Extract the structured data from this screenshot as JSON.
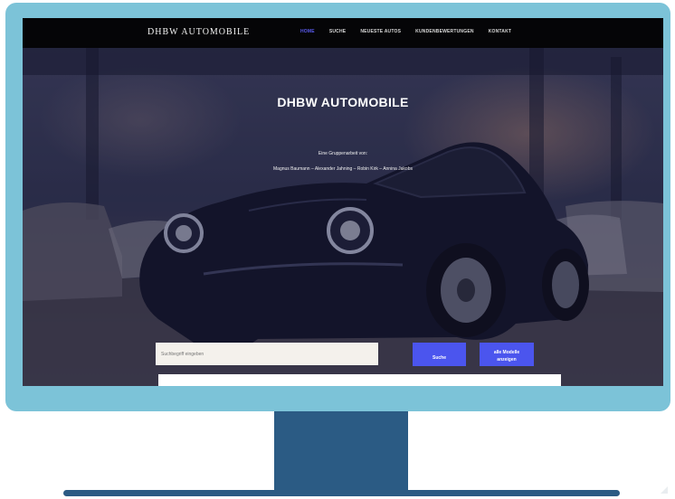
{
  "navbar": {
    "brand": "DHBW AUTOMOBILE",
    "links": [
      "Home",
      "Suche",
      "Neueste Autos",
      "Kundenbewertungen",
      "Kontakt"
    ],
    "active_index": 0
  },
  "hero": {
    "title": "DHBW AUTOMOBILE",
    "subtitle": "Eine Gruppenarbeit von:",
    "authors": "Magnus Baumann – Alexander Jahning – Robin Kirk – Annina Jakobs"
  },
  "search": {
    "placeholder": "Suchbegriff eingeben",
    "search_button": "Suche",
    "all_button_line1": "alle Modelle",
    "all_button_line2": "anzeigen"
  },
  "colors": {
    "accent": "#4b55ee",
    "navbar_bg": "#050507",
    "bezel": "#7cc3d8",
    "stand": "#2b5b84"
  }
}
